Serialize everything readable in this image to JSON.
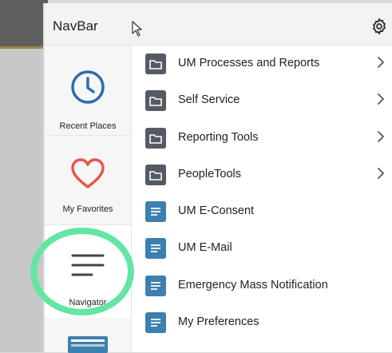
{
  "navbar": {
    "title": "NavBar",
    "settings_icon": "gear-icon"
  },
  "sidebar": {
    "items": [
      {
        "label": "Recent Places",
        "icon": "clock-icon",
        "color": "#2b6cb0"
      },
      {
        "label": "My Favorites",
        "icon": "heart-icon",
        "color": "#e05a4a"
      },
      {
        "label": "Navigator",
        "icon": "menu-lines-icon",
        "color": "#444444"
      },
      {
        "label": "",
        "icon": "classic-home-icon",
        "color": "#3d7fae"
      }
    ]
  },
  "menu": {
    "items": [
      {
        "label": "UM Processes and Reports",
        "type": "folder",
        "icon": "folder-icon",
        "has_submenu": true
      },
      {
        "label": "Self Service",
        "type": "folder",
        "icon": "folder-icon",
        "has_submenu": true
      },
      {
        "label": "Reporting Tools",
        "type": "folder",
        "icon": "folder-icon",
        "has_submenu": true
      },
      {
        "label": "PeopleTools",
        "type": "folder",
        "icon": "folder-icon",
        "has_submenu": true
      },
      {
        "label": "UM E-Consent",
        "type": "content",
        "icon": "document-icon",
        "has_submenu": false
      },
      {
        "label": "UM E-Mail",
        "type": "content",
        "icon": "document-icon",
        "has_submenu": false
      },
      {
        "label": "Emergency Mass Notification",
        "type": "content",
        "icon": "document-icon",
        "has_submenu": false
      },
      {
        "label": "My Preferences",
        "type": "content",
        "icon": "document-icon",
        "has_submenu": false
      }
    ]
  },
  "colors": {
    "folder_icon_bg": "#555b63",
    "content_icon_bg": "#3d7fae",
    "highlight_ring": "#63e6a2",
    "header_bg": "#f3f3f3"
  }
}
